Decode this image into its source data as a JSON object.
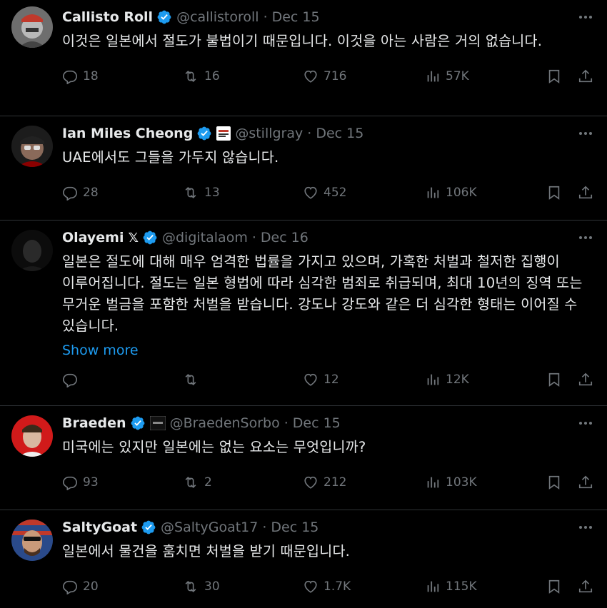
{
  "tweets": [
    {
      "name": "Callisto Roll",
      "handle": "@callistoroll",
      "sep": "·",
      "date": "Dec 15",
      "text": "이것은 일본에서 절도가 불법이기 때문입니다. 이것을 아는 사람은 거의 없습니다.",
      "show_more": "",
      "replies": "18",
      "retweets": "16",
      "likes": "716",
      "views": "57K"
    },
    {
      "name": "Ian Miles Cheong",
      "handle": "@stillgray",
      "sep": "·",
      "date": "Dec 15",
      "text": "UAE에서도 그들을 가두지 않습니다.",
      "show_more": "",
      "replies": "28",
      "retweets": "13",
      "likes": "452",
      "views": "106K"
    },
    {
      "name": "Olayemi",
      "handle": "@digitalaom",
      "sep": "·",
      "date": "Dec 16",
      "text": "일본은 절도에 대해 매우 엄격한 법률을 가지고 있으며, 가혹한 처벌과 철저한 집행이 이루어집니다. 절도는 일본 형법에 따라 심각한 범죄로 취급되며, 최대 10년의 징역 또는 무거운 벌금을 포함한 처벌을 받습니다. 강도나 강도와 같은 더 심각한 형태는 이어질 수 있습니다.",
      "show_more": "Show more",
      "replies": "",
      "retweets": "",
      "likes": "12",
      "views": "12K"
    },
    {
      "name": "Braeden",
      "handle": "@BraedenSorbo",
      "sep": "·",
      "date": "Dec 15",
      "text": "미국에는 있지만 일본에는 없는 요소는 무엇입니까?",
      "show_more": "",
      "replies": "93",
      "retweets": "2",
      "likes": "212",
      "views": "103K"
    },
    {
      "name": "SaltyGoat",
      "handle": "@SaltyGoat17",
      "sep": "·",
      "date": "Dec 15",
      "text": "일본에서 물건을 훔치면 처벌을 받기 때문입니다.",
      "show_more": "",
      "replies": "20",
      "retweets": "30",
      "likes": "1.7K",
      "views": "115K"
    }
  ],
  "colors": {
    "background": "#000000",
    "text": "#e7e9ea",
    "muted": "#71767b",
    "link": "#1d9bf0",
    "verified": "#1d9bf0",
    "divider": "#2f3336"
  },
  "icons": [
    "reply-icon",
    "retweet-icon",
    "like-icon",
    "views-icon",
    "bookmark-icon",
    "share-icon",
    "more-icon",
    "verified-badge-icon"
  ]
}
